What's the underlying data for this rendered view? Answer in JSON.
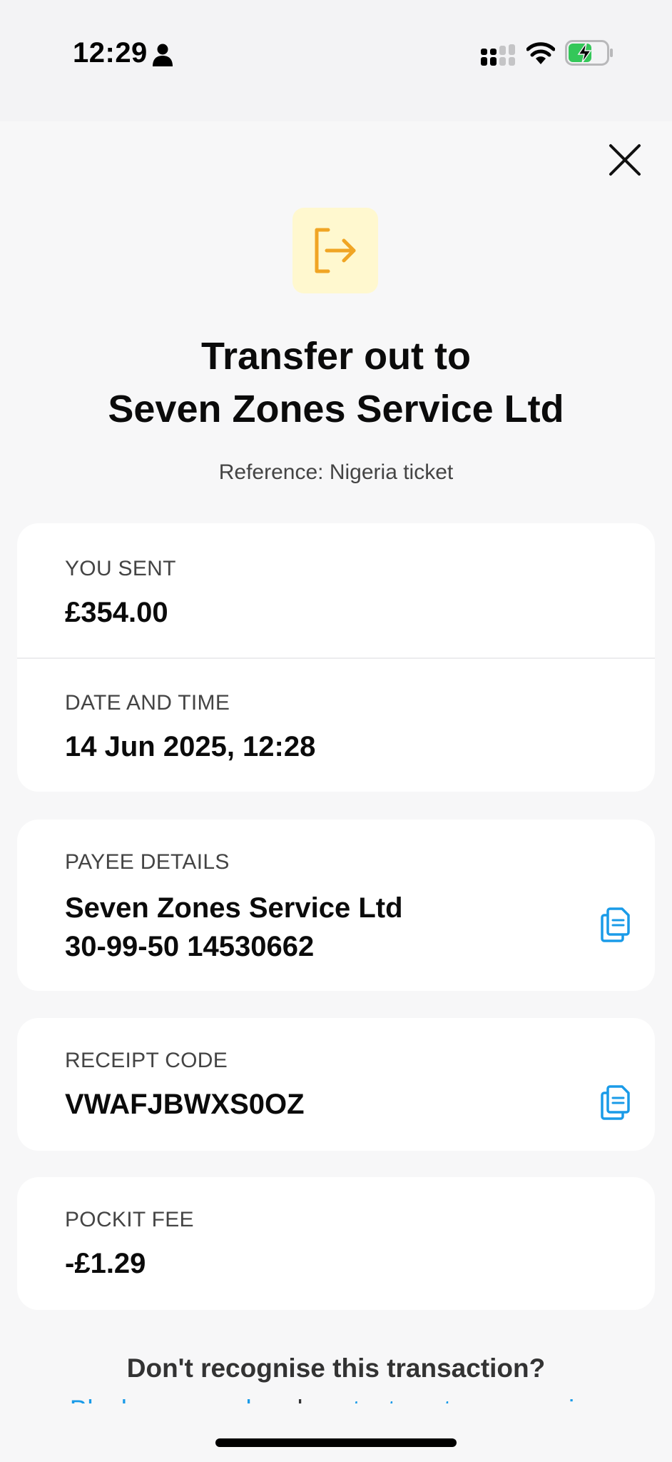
{
  "status_bar": {
    "time": "12:29",
    "icons": [
      "person-icon",
      "cellular-signal-icon",
      "wifi-icon",
      "battery-charging-icon"
    ]
  },
  "header": {
    "close_icon": "close-icon",
    "badge_icon": "transfer-out-icon",
    "title_line1": "Transfer out to",
    "title_line2": "Seven Zones Service Ltd",
    "reference": "Reference: Nigeria ticket"
  },
  "details": {
    "you_sent": {
      "label": "YOU SENT",
      "value": "£354.00"
    },
    "date_time": {
      "label": "DATE AND TIME",
      "value": "14 Jun 2025, 12:28"
    },
    "payee": {
      "label": "PAYEE DETAILS",
      "name": "Seven Zones Service Ltd",
      "account": "30-99-50 14530662",
      "copy_icon": "copy-icon"
    },
    "receipt": {
      "label": "RECEIPT CODE",
      "value": "VWAFJBWXS0OZ",
      "copy_icon": "copy-icon"
    },
    "fee": {
      "label": "POCKIT FEE",
      "value": "-£1.29"
    }
  },
  "footer": {
    "question": "Don't recognise this transaction?",
    "link_block_card": "Block your card",
    "conjunction": " and ",
    "link_contact": "contact customer service"
  },
  "colors": {
    "background": "#f7f7f8",
    "card": "#ffffff",
    "badge_bg": "#fff8cf",
    "badge_icon": "#f0a524",
    "link": "#1a9be8",
    "copy_icon": "#1a9be8",
    "battery": "#34c759"
  }
}
